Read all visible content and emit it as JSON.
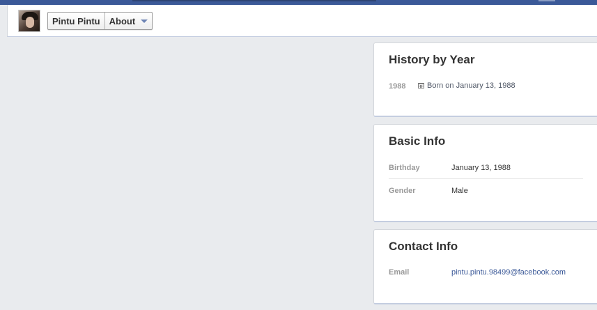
{
  "header": {
    "profile_name": "Pintu Pintu",
    "section_label": "About"
  },
  "history": {
    "title": "History by Year",
    "year": "1988",
    "event": "Born on January 13, 1988",
    "event_icon": "calendar-icon"
  },
  "basic_info": {
    "title": "Basic Info",
    "rows": [
      {
        "label": "Birthday",
        "value": "January 13, 1988"
      },
      {
        "label": "Gender",
        "value": "Male"
      }
    ]
  },
  "contact_info": {
    "title": "Contact Info",
    "rows": [
      {
        "label": "Email",
        "value": "pintu.pintu.98499@facebook.com"
      }
    ]
  },
  "colors": {
    "brand_blue": "#3b5998",
    "page_bg": "#e9ebee",
    "label_gray": "#999999",
    "link_blue": "#3b5998"
  }
}
